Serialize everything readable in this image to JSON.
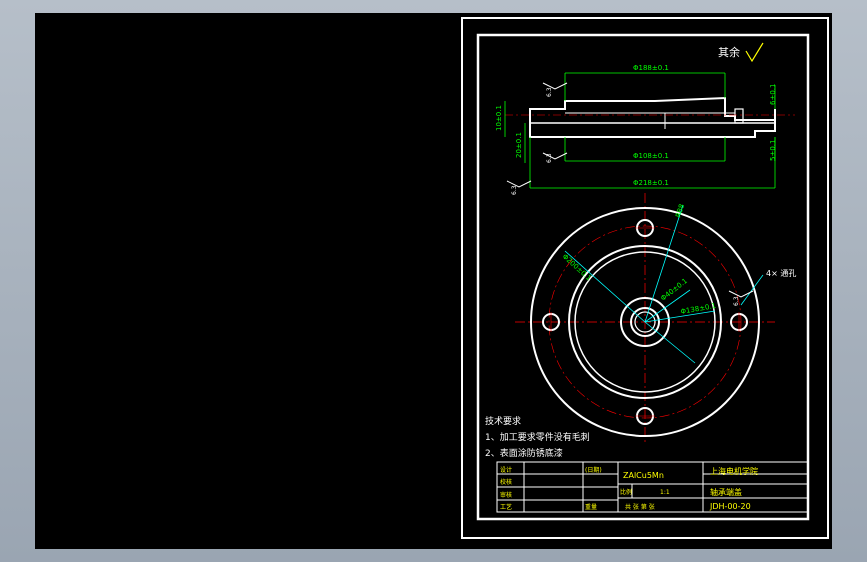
{
  "drawing": {
    "surface_note": "其余",
    "roughness_value": "6.3",
    "dimensions": {
      "top_diameter": "Φ188±0.1",
      "middle_diameter": "Φ108±0.1",
      "bottom_diameter": "Φ218±0.1",
      "left_height_1": "10±0.1",
      "left_height_2": "20±0.1",
      "right_height_1": "6±0.1",
      "right_height_2": "5±0.1",
      "hole_radius": "R88",
      "bore_diameter": "Φ40±0.1",
      "boss_diameter": "Φ138±0.1",
      "ring_diameter": "Φ200±0.1",
      "hole_callout": "4× 通孔"
    },
    "tech_requirements": {
      "title": "技术要求",
      "items": [
        "1、加工要求零件没有毛刺",
        "2、表面涂防锈底漆"
      ]
    },
    "title_block": {
      "row_labels": [
        "设计",
        "校核",
        "审核",
        "工艺"
      ],
      "std_label": "(日期)",
      "material": "ZAlCu5Mn",
      "school": "上海电机学院",
      "scale_label": "比例",
      "scale_value": "1:1",
      "part_name": "轴承端盖",
      "sheet_label": "共  张   第  张",
      "drawing_no": "JDH-00-20",
      "misc": [
        "重量",
        "共"
      ]
    }
  },
  "colors": {
    "background": "#000000",
    "lines": "#ffffff",
    "dimensions": "#00ff00",
    "centerlines": "#ff0000",
    "leaders": "#00ffff",
    "titleblock_text": "#ffff00"
  }
}
